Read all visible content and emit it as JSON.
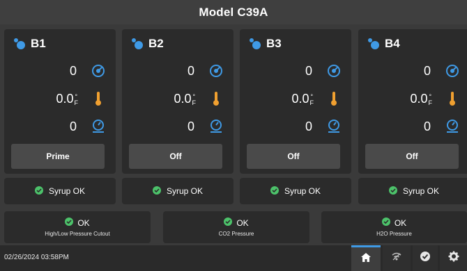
{
  "header": {
    "title": "Model C39A"
  },
  "banks": [
    {
      "name": "B1",
      "flow": "0",
      "temp_value": "0.0",
      "temp_unit_top": "°",
      "temp_unit_bottom": "F",
      "pressure": "0",
      "button_label": "Prime",
      "syrup_status": "Syrup OK"
    },
    {
      "name": "B2",
      "flow": "0",
      "temp_value": "0.0",
      "temp_unit_top": "°",
      "temp_unit_bottom": "F",
      "pressure": "0",
      "button_label": "Off",
      "syrup_status": "Syrup OK"
    },
    {
      "name": "B3",
      "flow": "0",
      "temp_value": "0.0",
      "temp_unit_top": "°",
      "temp_unit_bottom": "F",
      "pressure": "0",
      "button_label": "Off",
      "syrup_status": "Syrup OK"
    },
    {
      "name": "B4",
      "flow": "0",
      "temp_value": "0.0",
      "temp_unit_top": "°",
      "temp_unit_bottom": "F",
      "pressure": "0",
      "button_label": "Off",
      "syrup_status": "Syrup OK"
    }
  ],
  "system_status": [
    {
      "status": "OK",
      "label": "High/Low Pressure Cutout"
    },
    {
      "status": "OK",
      "label": "CO2 Pressure"
    },
    {
      "status": "OK",
      "label": "H2O Pressure"
    }
  ],
  "footer": {
    "datetime": "02/26/2024 03:58PM",
    "nav": [
      "home-icon",
      "wifi-icon",
      "check-circle-icon",
      "gear-icon"
    ]
  },
  "colors": {
    "background": "#3a3a3a",
    "panel": "#2b2b2b",
    "button": "#4a4a4a",
    "accent_blue": "#3f9ae6",
    "ok_green": "#4cc26a",
    "icon_orange": "#f0a030",
    "icon_blue": "#3f9ae6"
  }
}
